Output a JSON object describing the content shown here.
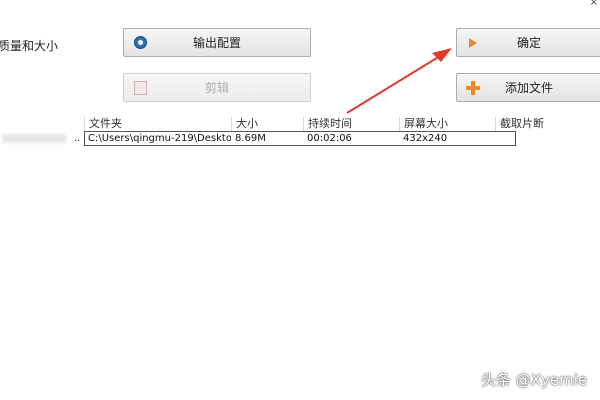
{
  "window": {
    "close_glyph": "×"
  },
  "left_label": "质量和大小",
  "buttons": {
    "export_config": {
      "label": "输出配置",
      "icon": "gear-icon"
    },
    "clip": {
      "label": "剪辑",
      "icon": "scissors-icon",
      "disabled": true
    },
    "confirm": {
      "label": "确定",
      "icon": "arrow-right-icon"
    },
    "add_file": {
      "label": "添加文件",
      "icon": "plus-icon"
    }
  },
  "table": {
    "columns": [
      "",
      "文件夹",
      "大小",
      "持续时间",
      "屏幕大小",
      "截取片断"
    ],
    "rows": [
      {
        "name_suffix": "..",
        "folder": "C:\\Users\\qingmu-219\\Deskto...",
        "size": "8.69M",
        "duration": "00:02:06",
        "screen_size": "432x240",
        "clip_segment": ""
      }
    ]
  },
  "watermark": "头条 @Xyemie",
  "colors": {
    "annotation_arrow": "#e23b2e",
    "accent_orange": "#f08a1c"
  }
}
